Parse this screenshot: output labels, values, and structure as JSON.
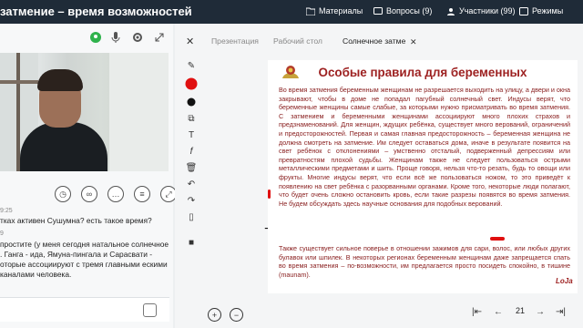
{
  "topbar": {
    "title": "затмение – время возможностей",
    "menu": {
      "materials": "Материалы",
      "questions": "Вопросы (9)",
      "participants": "Участники (99)",
      "modes": "Режимы"
    }
  },
  "chat": {
    "time1": "9:25",
    "msg1": "тках активен Сушумна? есть такое время?",
    "time2": "9",
    "msg2": "простите (у меня сегодня натальное солнечное . Ганга - ида, Ямуна-пингала и Сарасвати - оторые ассоциируют с тремя главными ескими каналами человека."
  },
  "board": {
    "tabs": {
      "presentation": "Презентация",
      "desktop": "Рабочий стол",
      "active": "Солнечное затме"
    },
    "slide": {
      "title": "Особые правила для беременных",
      "paragraph1": "Во время затмения беременным женщинам не разрешается выходить на улицу, а двери и окна закрывают, чтобы в доме не попадал пагубный солнечный свет. Индусы верят, что беременные женщины самые слабые, за которыми нужно присматривать во время затмения. С затмением и беременными женщинами ассоциируют много плохих страхов и предзнаменований. Для женщин, ждущих ребёнка, существует много верований, ограничений и предосторожностей. Первая и самая главная предосторожность – беременная женщина не должна смотреть на затмение. Им следует оставаться дома, иначе в результате появится на свет ребёнок с отклонениями – умственно отсталый, подверженный депрессиям или превратностям плохой судьбы. Женщинам также не следует пользоваться острыми металлическими предметами и шить. Проще говоря, нельзя что-то резать, будь то овощи или фрукты. Многие индусы верят, что если всё же пользоваться ножом, то это приведёт к появлению на свет ребёнка с разорванными органами. Кроме того, некоторые люди полагают, что будет очень сложно остановить кровь, если такие разрезы появятся во время затмения. Не будем обсуждать здесь научные основания для подобных верований.",
      "paragraph2": "Также существует сильное поверье в отношении зажимов для сари, волос, или любых других булавок или шпилек. В некоторых регионах беременным женщинам даже запрещается спать во время затмения – по-возможности, им предлагается просто посидеть спокойно, в тишине (maunam).",
      "signature": "LoJa"
    },
    "page_number": "21"
  }
}
